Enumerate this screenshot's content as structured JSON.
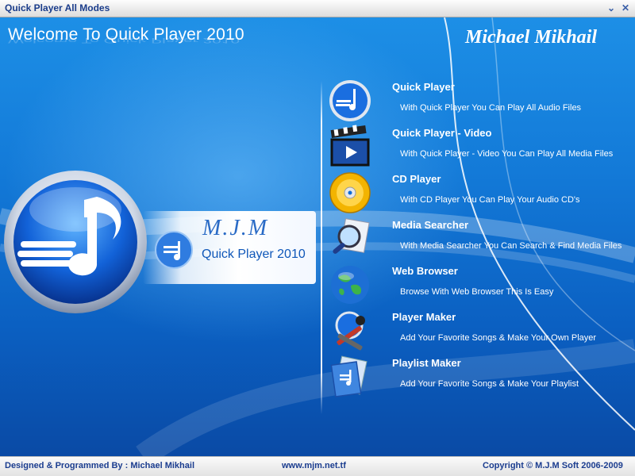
{
  "window": {
    "title": "Quick Player All Modes",
    "minimize_glyph": "⌄",
    "close_glyph": "✕"
  },
  "header": {
    "welcome": "Welcome To Quick Player 2010",
    "signature": "Michael Mikhail"
  },
  "badge": {
    "logo_text": "M.J.M",
    "product": "Quick Player 2010"
  },
  "menu": {
    "items": [
      {
        "title": "Quick Player",
        "desc": "With Quick Player You Can Play All Audio Files",
        "icon": "quick-player-icon"
      },
      {
        "title": "Quick Player - Video",
        "desc": "With Quick Player - Video You Can Play All Media Files",
        "icon": "film-clapper-icon"
      },
      {
        "title": "CD Player",
        "desc": "With CD Player You Can Play Your Audio CD's",
        "icon": "cd-disc-icon"
      },
      {
        "title": "Media Searcher",
        "desc": "With Media Searcher You Can Search & Find Media Files",
        "icon": "magnifier-icon"
      },
      {
        "title": "Web Browser",
        "desc": "Browse With Web Browser This Is Easy",
        "icon": "globe-icon"
      },
      {
        "title": "Player Maker",
        "desc": "Add Your Favorite Songs & Make Your Own Player",
        "icon": "player-maker-icon"
      },
      {
        "title": "Playlist Maker",
        "desc": "Add Your Favorite Songs & Make Your Playlist",
        "icon": "playlist-icon"
      }
    ]
  },
  "statusbar": {
    "designer": "Designed & Programmed By : Michael Mikhail",
    "site": "www.mjm.net.tf",
    "copyright": "Copyright © M.J.M Soft 2006-2009"
  },
  "colors": {
    "background_top": "#1d8fe6",
    "background_bottom": "#0a4aa5",
    "title_text": "#1a3c8a",
    "status_text": "#1b3d8f"
  }
}
